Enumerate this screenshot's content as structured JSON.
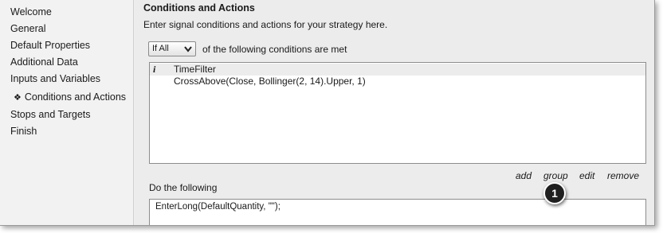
{
  "sidebar": {
    "items": [
      {
        "label": "Welcome"
      },
      {
        "label": "General"
      },
      {
        "label": "Default Properties"
      },
      {
        "label": "Additional Data"
      },
      {
        "label": "Inputs and Variables"
      },
      {
        "label": "Conditions and Actions",
        "active": true
      },
      {
        "label": "Stops and Targets"
      },
      {
        "label": "Finish"
      }
    ],
    "active_marker": "❖"
  },
  "main": {
    "section_title": "Conditions and Actions",
    "subtitle": "Enter signal conditions and actions for your strategy here.",
    "condition_mode": {
      "selected": "If All"
    },
    "conditions_label": "of the following conditions are met",
    "conditions": [
      {
        "icon": "info-icon",
        "glyph": "i",
        "text": "TimeFilter"
      },
      {
        "text": "CrossAbove(Close, Bollinger(2, 14).Upper, 1)"
      }
    ],
    "links": {
      "add": "add",
      "group": "group",
      "edit": "edit",
      "remove": "remove"
    },
    "do_label": "Do the following",
    "callout_number": "1",
    "action_text": "EnterLong(DefaultQuantity, \"\");"
  }
}
